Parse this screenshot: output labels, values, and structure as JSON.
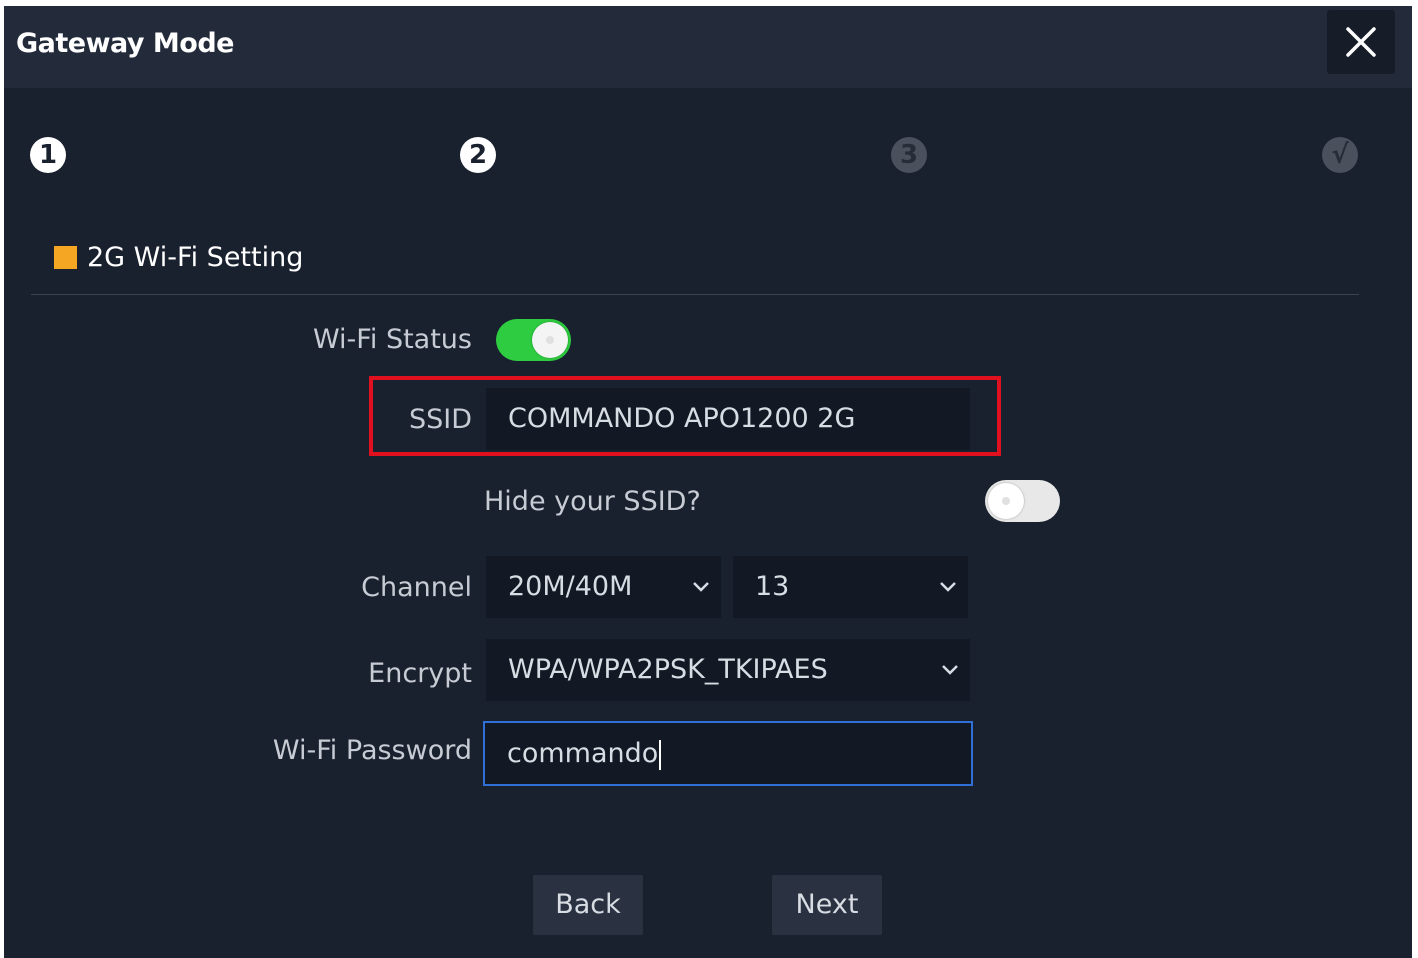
{
  "dialog": {
    "title": "Gateway Mode",
    "close_label": "close"
  },
  "steps": [
    {
      "label": "1",
      "state": "active"
    },
    {
      "label": "2",
      "state": "active"
    },
    {
      "label": "3",
      "state": "inactive"
    },
    {
      "label": "√",
      "state": "inactive"
    }
  ],
  "section": {
    "title": "2G Wi-Fi Setting",
    "marker_color": "#f5a623"
  },
  "form": {
    "wifi_status": {
      "label": "Wi-Fi Status",
      "enabled": true
    },
    "ssid": {
      "label": "SSID",
      "value": "COMMANDO APO1200 2G"
    },
    "hide_ssid": {
      "label": "Hide your SSID?",
      "enabled": false
    },
    "channel": {
      "label": "Channel",
      "bandwidth": "20M/40M",
      "number": "13"
    },
    "encrypt": {
      "label": "Encrypt",
      "value": "WPA/WPA2PSK_TKIPAES"
    },
    "password": {
      "label": "Wi-Fi Password",
      "value": "commando"
    }
  },
  "buttons": {
    "back": "Back",
    "next": "Next"
  },
  "colors": {
    "background": "#19202e",
    "titlebar": "#232b3b",
    "toggle_on": "#2ecc40",
    "highlight": "#e0101e",
    "focus": "#2f6fd6"
  }
}
